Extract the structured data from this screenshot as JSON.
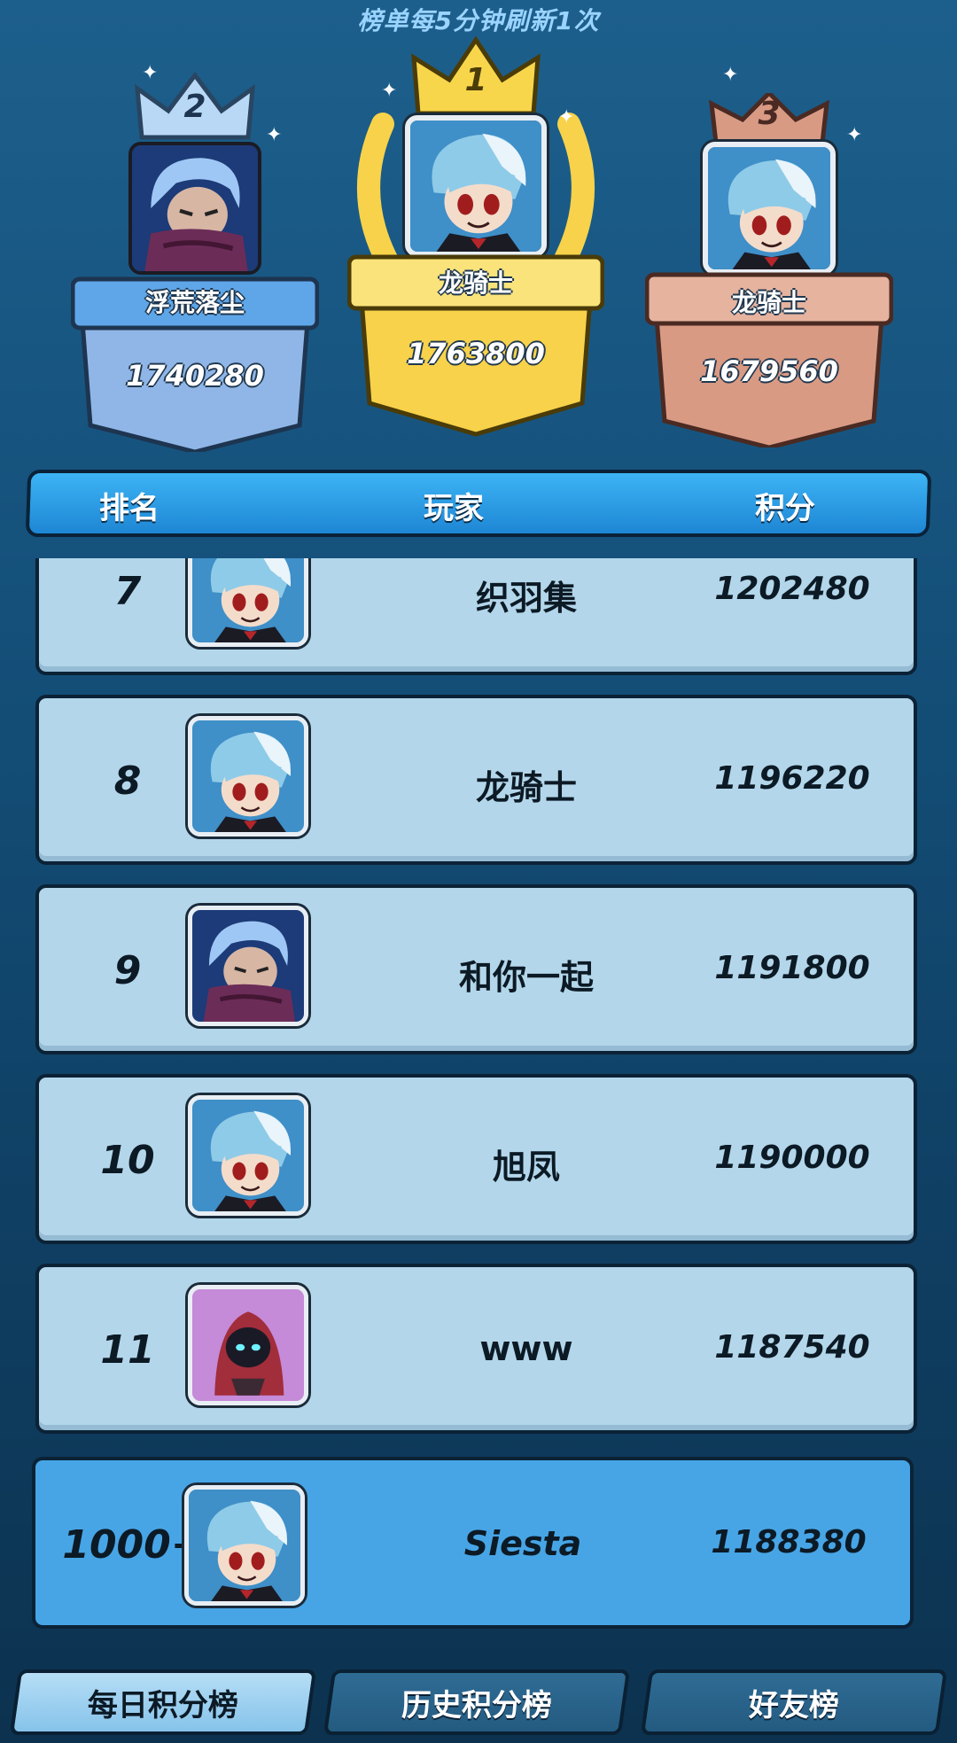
{
  "notice": "榜单每5分钟刷新1次",
  "podium": [
    {
      "place": "2",
      "name": "浮荒落尘",
      "score": "1740280",
      "avatar": "hero-ninja-icon"
    },
    {
      "place": "1",
      "name": "龙骑士",
      "score": "1763800",
      "avatar": "hero-default-icon"
    },
    {
      "place": "3",
      "name": "龙骑士",
      "score": "1679560",
      "avatar": "hero-default-icon"
    }
  ],
  "table_header": {
    "rank": "排名",
    "player": "玩家",
    "score": "积分"
  },
  "rows": [
    {
      "rank": "7",
      "name": "织羽集",
      "score": "1202480",
      "avatar": "hero-default-icon"
    },
    {
      "rank": "8",
      "name": "龙骑士",
      "score": "1196220",
      "avatar": "hero-default-icon"
    },
    {
      "rank": "9",
      "name": "和你一起",
      "score": "1191800",
      "avatar": "hero-ninja-icon"
    },
    {
      "rank": "10",
      "name": "旭凤",
      "score": "1190000",
      "avatar": "hero-default-icon"
    },
    {
      "rank": "11",
      "name": "www",
      "score": "1187540",
      "avatar": "hooded-mage-icon"
    }
  ],
  "self": {
    "rank": "1000+",
    "name": "Siesta",
    "score": "1188380",
    "avatar": "hero-default-icon"
  },
  "tabs": [
    {
      "label": "每日积分榜",
      "active": true
    },
    {
      "label": "历史积分榜",
      "active": false
    },
    {
      "label": "好友榜",
      "active": false
    }
  ],
  "colors": {
    "gold": "#f7d24a",
    "silver": "#a9c9ee",
    "bronze": "#d99a84",
    "row": "#b3d6ea",
    "self_row": "#47a5e6"
  }
}
